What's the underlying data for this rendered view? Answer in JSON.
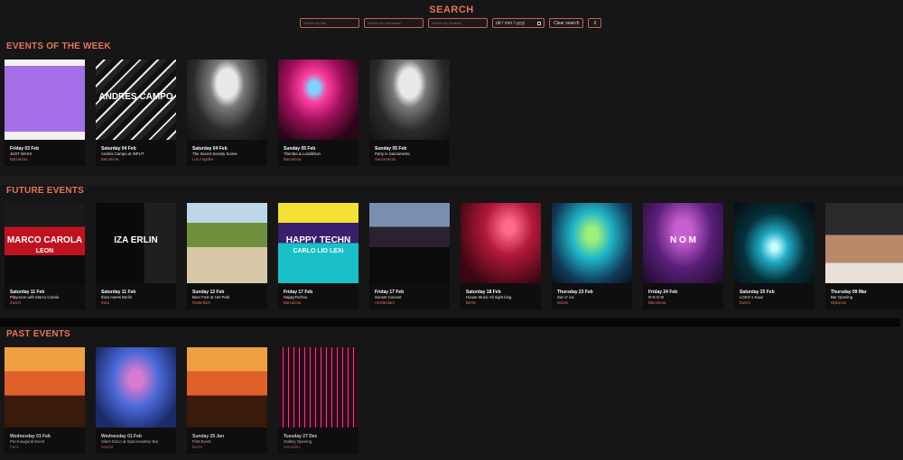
{
  "search": {
    "title": "SEARCH",
    "title_placeholder": "Search by title",
    "username_placeholder": "Search by username",
    "location_placeholder": "Search by location",
    "date_value": "dd / mm / yyyy",
    "clear_label": "Clear search",
    "close_label": "X"
  },
  "sections": {
    "week": "EVENTS OF THE WEEK",
    "future": "FUTURE EVENTS",
    "past": "PAST EVENTS"
  },
  "week_events": [
    {
      "date": "Friday 03 Feb",
      "name": "JUST WAXX",
      "city": "Barcelona",
      "image": "poster-purple"
    },
    {
      "date": "Saturday 04 Feb",
      "name": "Andrés Campo at INPUT",
      "city": "Barcelona",
      "image": "poster-bw-graphic",
      "image_text": "ANDRES CAMPO"
    },
    {
      "date": "Saturday 04 Feb",
      "name": "The Secret Society Soiree",
      "city": "Los Angeles",
      "image": "photo-bw-crowd"
    },
    {
      "date": "Sunday 05 Feb",
      "name": "Themba & Landikhon",
      "city": "Barcelona",
      "image": "photo-pink-stage"
    },
    {
      "date": "Sunday 05 Feb",
      "name": "Party in Sacramento",
      "city": "Sacramento",
      "image": "photo-bw-crowd"
    }
  ],
  "future_events": [
    {
      "date": "Saturday 11 Feb",
      "name": "Playroom with Marco Carola",
      "city": "Zurich",
      "image": "poster-marco",
      "image_text": "MARCO CAROLA",
      "image_text2": "LEON"
    },
    {
      "date": "Saturday 11 Feb",
      "name": "Ibiza meets Berlin",
      "city": "Ibiza",
      "image": "poster-ibiza",
      "image_text": "IZA ERLIN"
    },
    {
      "date": "Sunday 12 Feb",
      "name": "Beer Fest at Het Park",
      "city": "Rotterdam",
      "image": "photo-park"
    },
    {
      "date": "Friday 17 Feb",
      "name": "HappyTechno",
      "city": "Barcelona",
      "image": "poster-happy",
      "image_text": "HAPPY TECHN",
      "image_text2": "CARLO LIO  LEXI"
    },
    {
      "date": "Friday 17 Feb",
      "name": "Sunset Concert",
      "city": "Amsterdam",
      "image": "photo-sunset-stage"
    },
    {
      "date": "Saturday 18 Feb",
      "name": "House Music All night long",
      "city": "Berlin",
      "image": "photo-red-club"
    },
    {
      "date": "Thursday 23 Feb",
      "name": "Sun n' ice",
      "city": "Davos",
      "image": "photo-green-lasers"
    },
    {
      "date": "Friday 24 Feb",
      "name": "Θ N O M",
      "city": "Barcelona",
      "image": "photo-nom",
      "image_text": "N O M"
    },
    {
      "date": "Saturday 25 Feb",
      "name": "LOKO x Kauz",
      "city": "Zurich",
      "image": "photo-teal-lights"
    },
    {
      "date": "Thursday 09 Mar",
      "name": "Bar Opening",
      "city": "Mykonos",
      "image": "photo-party-people"
    }
  ],
  "past_events": [
    {
      "date": "Wednesday 01 Feb",
      "name": "Pre-Inaugural Event",
      "city": "Paris",
      "image": "photo-orange-crowd"
    },
    {
      "date": "Wednesday 01 Feb",
      "name": "Silent Disco at Spacecowboy Bar",
      "city": "Madrid",
      "image": "photo-blue-disco"
    },
    {
      "date": "Sunday 29 Jan",
      "name": "First Event",
      "city": "Berlin",
      "image": "photo-orange-crowd"
    },
    {
      "date": "Tuesday 27 Dec",
      "name": "Gallery Opening",
      "city": "Versailles",
      "image": "photo-red-lasers"
    }
  ],
  "colors": {
    "accent": "#e8735a",
    "background": "#161616",
    "card": "#0e0e0e"
  }
}
